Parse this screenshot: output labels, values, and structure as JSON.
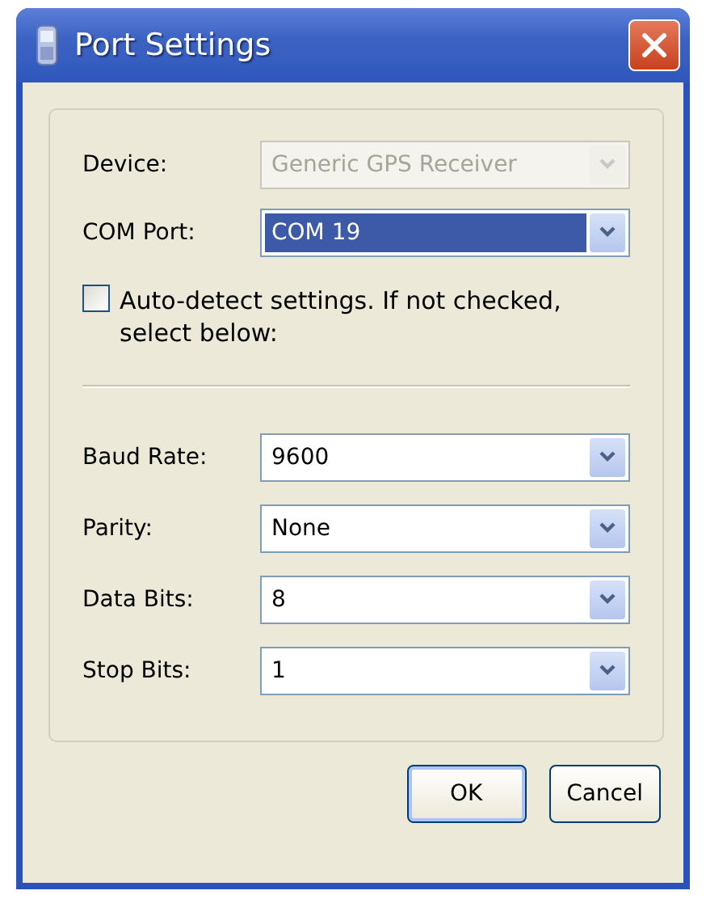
{
  "window": {
    "title": "Port Settings"
  },
  "top_fields": [
    {
      "label": "Device:",
      "value": "Generic GPS Receiver",
      "disabled": true,
      "selected": false
    },
    {
      "label": "COM Port:",
      "value": "COM 19",
      "disabled": false,
      "selected": true
    }
  ],
  "auto_detect": {
    "label": "Auto-detect settings. If not checked, select below:",
    "checked": false
  },
  "serial_fields": [
    {
      "label": "Baud Rate:",
      "value": "9600",
      "disabled": false,
      "selected": false
    },
    {
      "label": "Parity:",
      "value": "None",
      "disabled": false,
      "selected": false
    },
    {
      "label": "Data Bits:",
      "value": "8",
      "disabled": false,
      "selected": false
    },
    {
      "label": "Stop Bits:",
      "value": "1",
      "disabled": false,
      "selected": false
    }
  ],
  "buttons": [
    {
      "label": "OK",
      "default": true
    },
    {
      "label": "Cancel",
      "default": false
    }
  ]
}
